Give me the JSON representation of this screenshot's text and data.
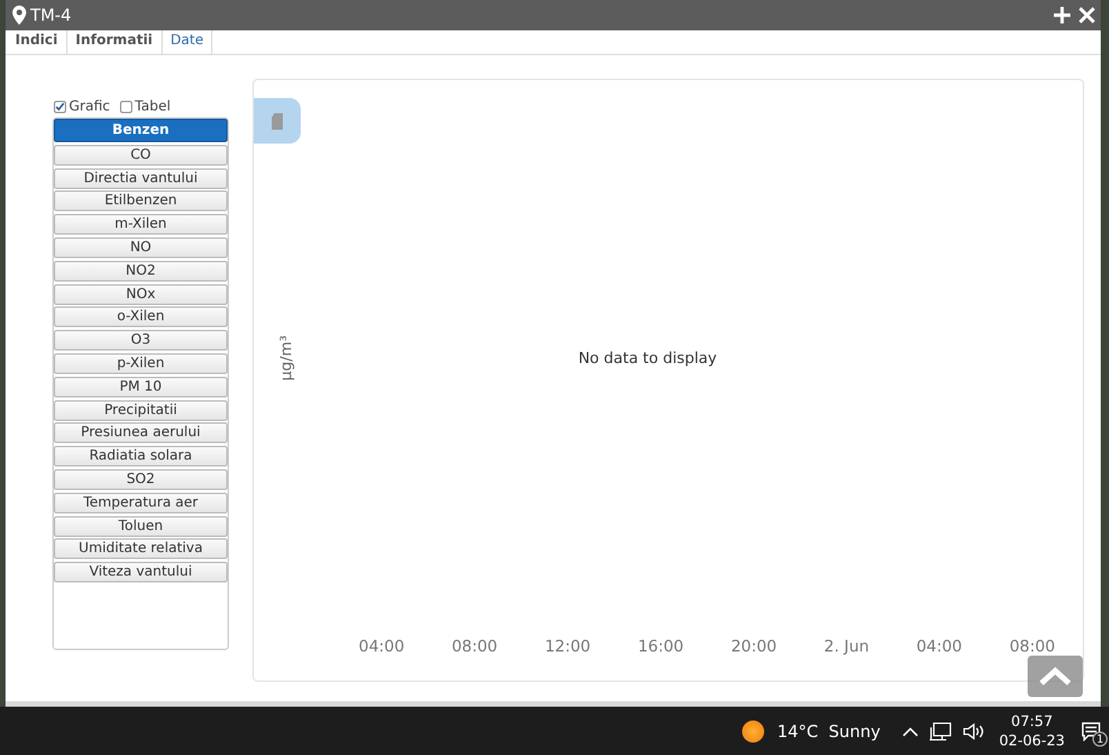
{
  "window": {
    "title": "TM-4"
  },
  "tabs": [
    {
      "label": "Indici",
      "selected": false
    },
    {
      "label": "Informatii",
      "selected": false
    },
    {
      "label": "Date",
      "selected": true
    }
  ],
  "view_options": [
    {
      "label": "Grafic",
      "checked": true
    },
    {
      "label": "Tabel",
      "checked": false
    }
  ],
  "parameters": [
    {
      "label": "Benzen",
      "selected": true
    },
    {
      "label": "CO",
      "selected": false
    },
    {
      "label": "Directia vantului",
      "selected": false
    },
    {
      "label": "Etilbenzen",
      "selected": false
    },
    {
      "label": "m-Xilen",
      "selected": false
    },
    {
      "label": "NO",
      "selected": false
    },
    {
      "label": "NO2",
      "selected": false
    },
    {
      "label": "NOx",
      "selected": false
    },
    {
      "label": "o-Xilen",
      "selected": false
    },
    {
      "label": "O3",
      "selected": false
    },
    {
      "label": "p-Xilen",
      "selected": false
    },
    {
      "label": "PM 10",
      "selected": false
    },
    {
      "label": "Precipitatii",
      "selected": false
    },
    {
      "label": "Presiunea aerului",
      "selected": false
    },
    {
      "label": "Radiatia solara",
      "selected": false
    },
    {
      "label": "SO2",
      "selected": false
    },
    {
      "label": "Temperatura aer",
      "selected": false
    },
    {
      "label": "Toluen",
      "selected": false
    },
    {
      "label": "Umiditate relativa",
      "selected": false
    },
    {
      "label": "Viteza vantului",
      "selected": false
    }
  ],
  "chart": {
    "ylabel": "µg/m³",
    "message": "No data to display",
    "x_labels": [
      "04:00",
      "08:00",
      "12:00",
      "16:00",
      "20:00",
      "2. Jun",
      "04:00",
      "08:00"
    ]
  },
  "taskbar": {
    "weather": "14°C  Sunny",
    "time": "07:57",
    "date": "02-06-23",
    "notifications": "1"
  }
}
